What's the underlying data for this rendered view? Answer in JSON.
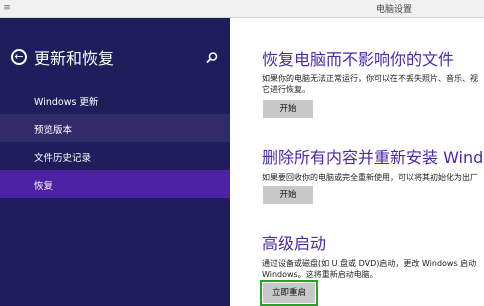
{
  "window": {
    "title": "电脑设置"
  },
  "sidebar": {
    "title": "更新和恢复",
    "items": [
      {
        "label": "Windows 更新"
      },
      {
        "label": "预览版本"
      },
      {
        "label": "文件历史记录"
      },
      {
        "label": "恢复"
      }
    ]
  },
  "main": {
    "sections": [
      {
        "title": "恢复电脑而不影响你的文件",
        "desc": [
          "如果你的电脑无法正常运行，你可以在不丢失照片、音乐、视",
          "它进行恢复。"
        ],
        "button": "开始"
      },
      {
        "title": "删除所有内容并重新安装 Windows",
        "desc": [
          "如果要回收你的电脑或完全重新使用，可以将其初始化为出厂"
        ],
        "button": "开始"
      },
      {
        "title": "高级启动",
        "desc": [
          "通过设备或磁盘(如 U 盘或 DVD)启动，更改 Windows 启动",
          "Windows。这将重新启动电脑。"
        ],
        "button": "立即重启"
      }
    ]
  },
  "colors": {
    "sidebar_bg": "#1e1e5c",
    "active_item": "#4d21a3",
    "accent_title": "#4a2aa6",
    "highlight_box": "#2f9e2f"
  }
}
